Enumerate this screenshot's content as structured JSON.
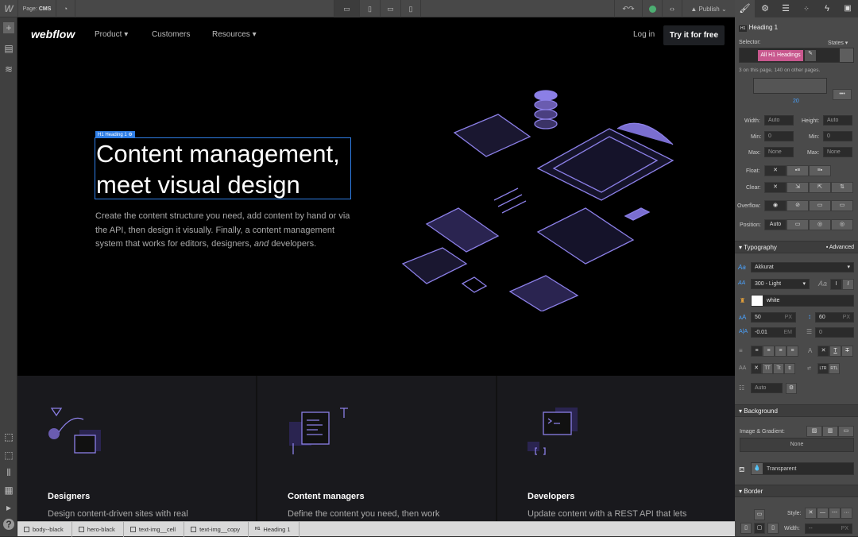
{
  "topbar": {
    "page_label": "Page:",
    "page_name": "CMS",
    "publish": "Publish"
  },
  "site": {
    "logo": "webflow",
    "nav": [
      "Product",
      "Customers",
      "Resources"
    ],
    "login": "Log in",
    "cta": "Try it for free",
    "selected_tag": "H1 Heading 1",
    "headline_1": "Content management,",
    "headline_2": "meet visual design",
    "body_pre": "Create the content structure you need, add content by hand or via the API, then design it visually. Finally, a content management system that works for editors, designers, ",
    "body_em": "and",
    "body_post": " developers.",
    "cards": [
      {
        "title": "Designers",
        "text": "Design content-driven sites with real"
      },
      {
        "title": "Content managers",
        "text": "Define the content you need, then work"
      },
      {
        "title": "Developers",
        "text": "Update content with a REST API that lets"
      }
    ]
  },
  "panel": {
    "element_tag": "H1",
    "element_name": "Heading 1",
    "selector_label": "Selector:",
    "states": "States",
    "selector_class": "All H1 Headings",
    "selector_color": "#c8588e",
    "selector_note": "3 on this page, 140 on other pages.",
    "margin_value": "20",
    "width_label": "Width:",
    "width": "Auto",
    "height_label": "Height:",
    "height": "Auto",
    "min_label": "Min:",
    "min_w": "0",
    "min_h": "0",
    "px": "PX",
    "max_label": "Max:",
    "max_w": "None",
    "max_h": "None",
    "float_label": "Float:",
    "clear_label": "Clear:",
    "overflow_label": "Overflow:",
    "position_label": "Position:",
    "position": "Auto",
    "typography": "Typography",
    "advanced": "Advanced",
    "font": "Akkurat",
    "weight": "300 - Light",
    "color": "white",
    "font_size": "50",
    "line_height": "60",
    "letter_spacing": "-0.01",
    "em": "EM",
    "text_indent": "0",
    "columns": "Auto",
    "background": "Background",
    "image_gradient": "Image & Gradient:",
    "bg_none": "None",
    "bg_color": "Transparent",
    "border": "Border",
    "style_label": "Style:",
    "width_label2": "Width:",
    "border_width": "--"
  },
  "breadcrumbs": [
    {
      "icon": "body-icon",
      "label": "body--black"
    },
    {
      "icon": "div-icon",
      "label": "hero-black"
    },
    {
      "icon": "div-icon",
      "label": "text-img__cell"
    },
    {
      "icon": "div-icon",
      "label": "text-img__copy"
    },
    {
      "icon": "h1-icon",
      "label": "Heading 1",
      "tag": "H1"
    }
  ],
  "colors": {
    "accent": "#7b6fd6",
    "selection": "#2f7ee6",
    "check": "#4caf72"
  }
}
